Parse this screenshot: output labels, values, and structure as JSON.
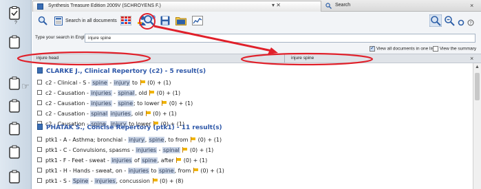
{
  "window": {
    "tab1_title": "Synthesis Treasure Edition 2009V (SCHROYENS F.)",
    "tab1_controls": "▾ ✕",
    "tab2_title": "Search",
    "close": "×"
  },
  "toolbar": {
    "search_all_label": "Search in all documents"
  },
  "search": {
    "label": "Type your search in English:",
    "value": "injure spine"
  },
  "options": {
    "view_all_label": "View all documents in one list",
    "view_all_checked": true,
    "view_summary_label": "View the summary",
    "view_summary_checked": false
  },
  "panes": {
    "left_query": "injure head",
    "right_query": "injure spine",
    "close": "×"
  },
  "results": {
    "group1": {
      "title": "CLARKE J., Clinical Repertory (c2) -  5 result(s)",
      "lines": [
        {
          "parts": [
            [
              "c2 - Clinical - S - ",
              0
            ],
            [
              "spine",
              1
            ],
            [
              " - ",
              0
            ],
            [
              "injury",
              1
            ],
            [
              " to ",
              0
            ],
            [
              "F",
              2
            ],
            [
              " (0)  + (1)",
              0
            ]
          ]
        },
        {
          "parts": [
            [
              "c2 - Causation - ",
              0
            ],
            [
              "injuries",
              1
            ],
            [
              " - ",
              0
            ],
            [
              "spinal",
              1
            ],
            [
              ", old ",
              0
            ],
            [
              "F",
              2
            ],
            [
              " (0)  + (1)",
              0
            ]
          ]
        },
        {
          "parts": [
            [
              "c2 - Causation - ",
              0
            ],
            [
              "injuries",
              1
            ],
            [
              " - ",
              0
            ],
            [
              "spine",
              1
            ],
            [
              "; to lower ",
              0
            ],
            [
              "F",
              2
            ],
            [
              " (0)  + (1)",
              0
            ]
          ]
        },
        {
          "parts": [
            [
              "c2 - Causation - ",
              0
            ],
            [
              "spinal",
              1
            ],
            [
              " ",
              0
            ],
            [
              "injuries",
              1
            ],
            [
              ", old ",
              0
            ],
            [
              "F",
              2
            ],
            [
              " (0)  + (1)",
              0
            ]
          ]
        },
        {
          "parts": [
            [
              "c2 - Causation - ",
              0
            ],
            [
              "spine",
              1
            ],
            [
              ", ",
              0
            ],
            [
              "injury",
              1
            ],
            [
              " to lower ",
              0
            ],
            [
              "F",
              2
            ],
            [
              " (0)  + (1)",
              0
            ]
          ]
        }
      ]
    },
    "group2": {
      "title": "PHATAK S., Concise Repertory (ptk1) - 11 result(s)",
      "lines": [
        {
          "parts": [
            [
              "ptk1 - A - Asthma; bronchial - ",
              0
            ],
            [
              "injury",
              1
            ],
            [
              ", ",
              0
            ],
            [
              "spine",
              1
            ],
            [
              ", to from ",
              0
            ],
            [
              "F",
              2
            ],
            [
              " (0)  + (1)",
              0
            ]
          ]
        },
        {
          "parts": [
            [
              "ptk1 - C - Convulsions, spasms - ",
              0
            ],
            [
              "injuries",
              1
            ],
            [
              " - ",
              0
            ],
            [
              "spinal",
              1
            ],
            [
              " ",
              0
            ],
            [
              "F",
              2
            ],
            [
              " (0)  + (1)",
              0
            ]
          ]
        },
        {
          "parts": [
            [
              "ptk1 - F - Feet - sweat - ",
              0
            ],
            [
              "injuries",
              1
            ],
            [
              " of ",
              0
            ],
            [
              "spine",
              1
            ],
            [
              ", after ",
              0
            ],
            [
              "F",
              2
            ],
            [
              " (0)  + (1)",
              0
            ]
          ]
        },
        {
          "parts": [
            [
              "ptk1 - H - Hands - sweat, on - ",
              0
            ],
            [
              "injuries",
              1
            ],
            [
              " to ",
              0
            ],
            [
              "spine",
              1
            ],
            [
              ", from ",
              0
            ],
            [
              "F",
              2
            ],
            [
              " (0)  + (1)",
              0
            ]
          ]
        },
        {
          "parts": [
            [
              "ptk1 - S - ",
              0
            ],
            [
              "Spine",
              1
            ],
            [
              " - ",
              0
            ],
            [
              "injuries",
              1
            ],
            [
              ", concussion ",
              0
            ],
            [
              "F",
              2
            ],
            [
              " (0)  + (8)",
              0
            ]
          ]
        }
      ]
    }
  },
  "colors": {
    "annotation": "#e0202a",
    "highlight": "#c9d4e6",
    "group_title": "#2c56a8"
  }
}
